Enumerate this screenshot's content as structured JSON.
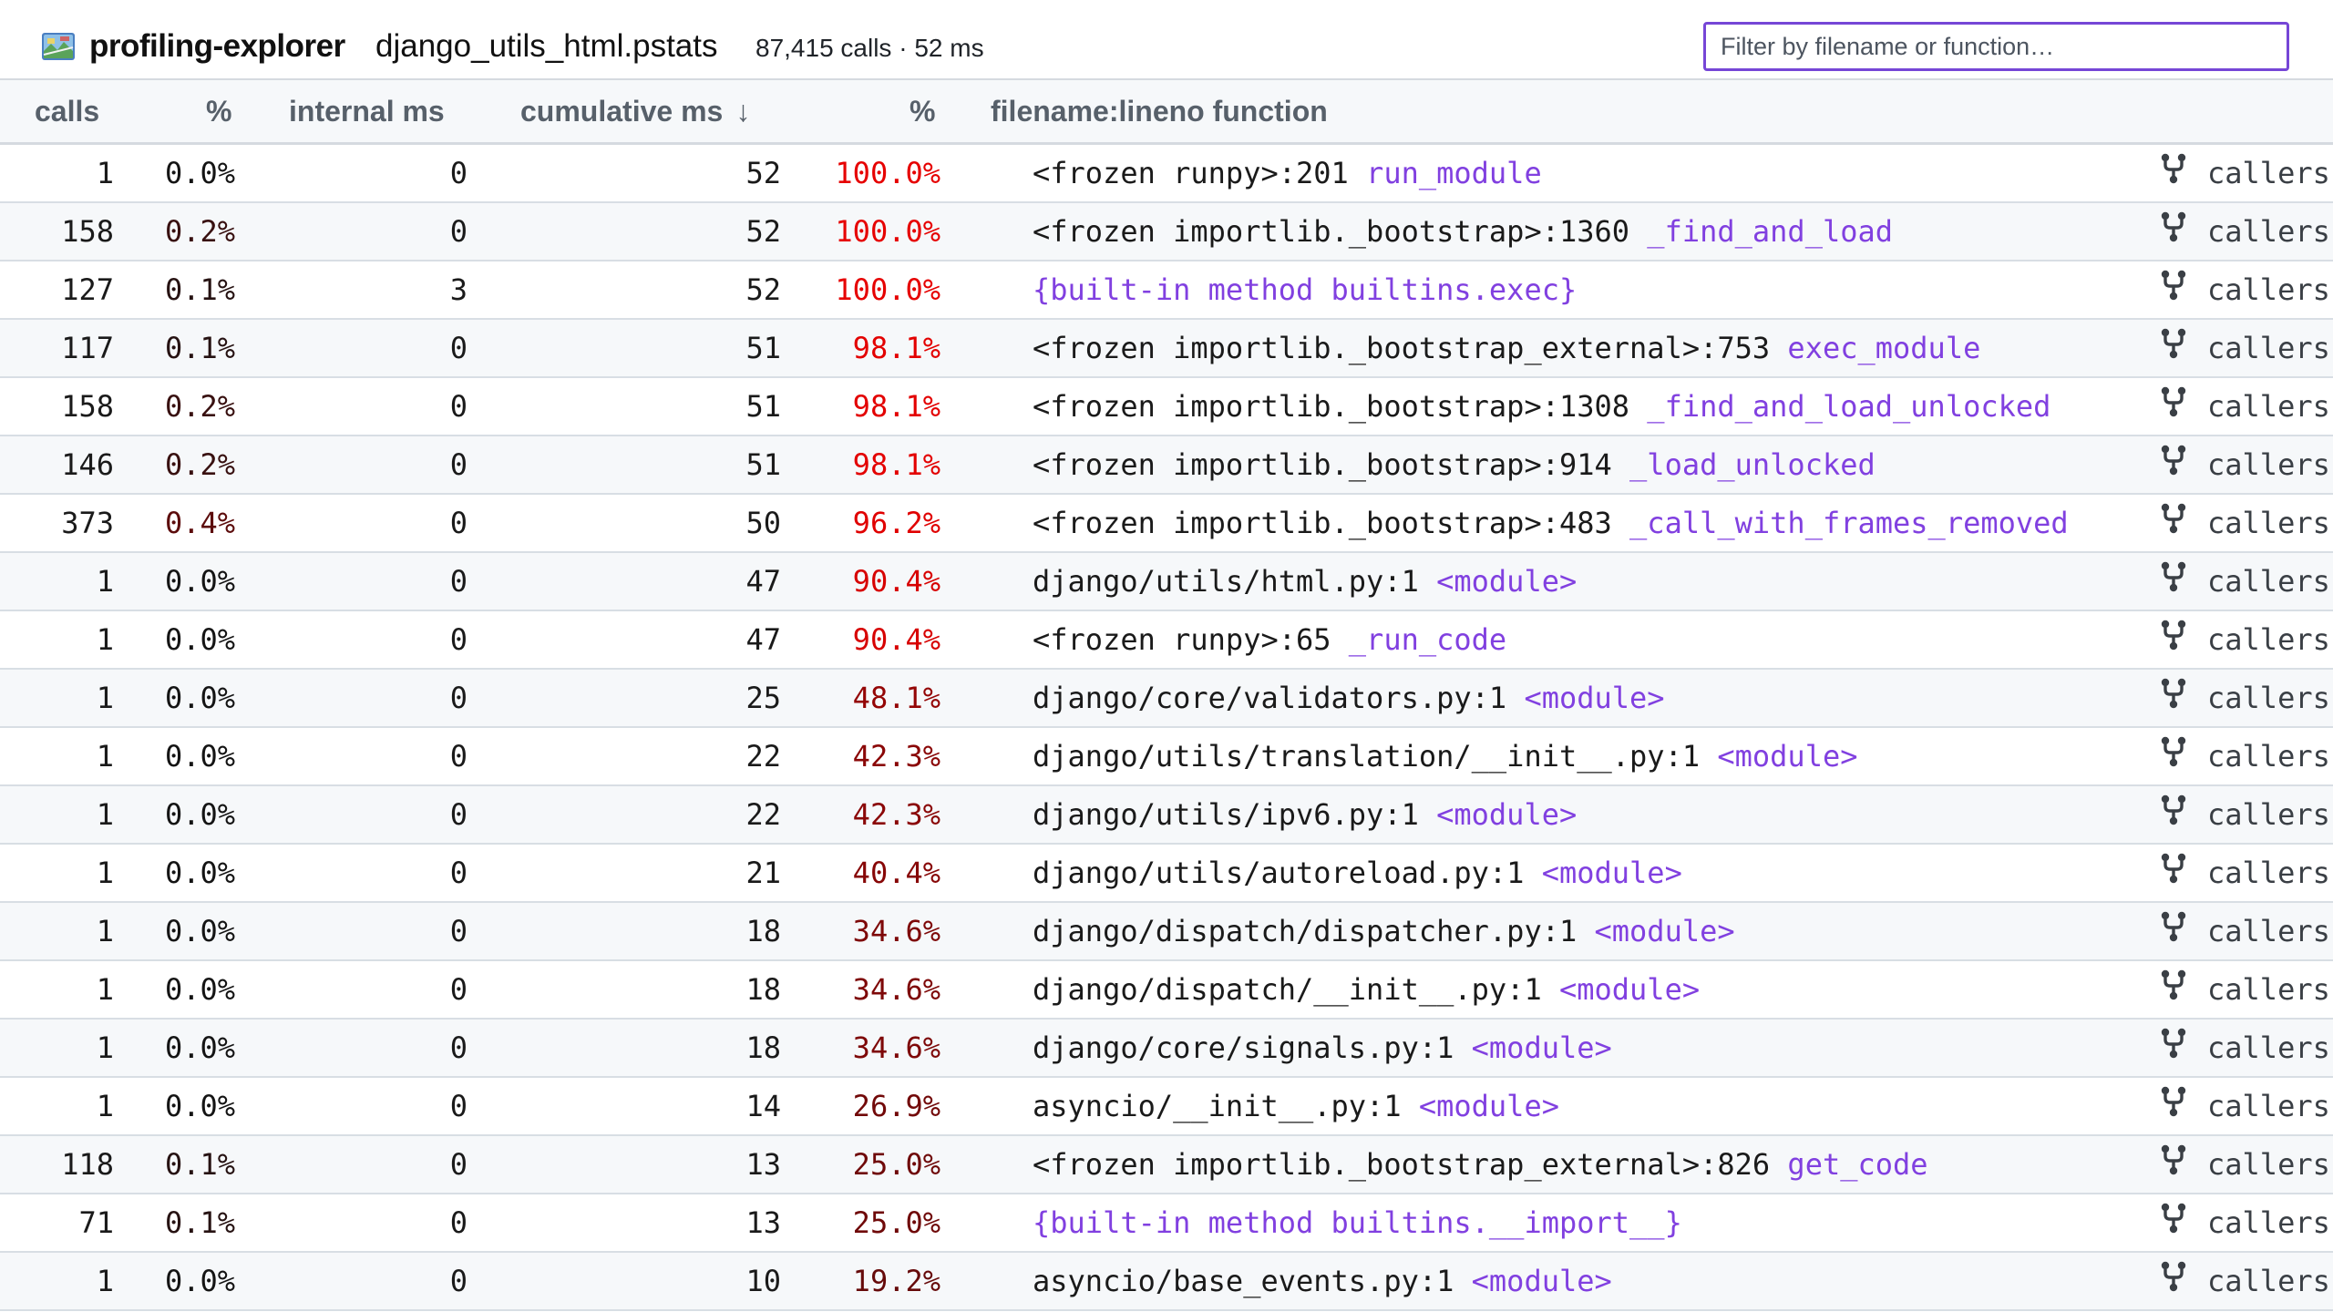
{
  "header": {
    "app_title": "profiling-explorer",
    "file_name": "django_utils_html.pstats",
    "stats": "87,415 calls · 52 ms",
    "filter_placeholder": "Filter by filename or function…"
  },
  "columns": {
    "calls": "calls",
    "pct1": "%",
    "internal": "internal ms",
    "cumulative": "cumulative ms",
    "sort_arrow": "↓",
    "pct2": "%",
    "function": "filename:lineno function"
  },
  "callers_label": "callers",
  "icons": {
    "logo": "map-icon",
    "callers": "fork-icon"
  },
  "colors": {
    "accent": "#7646d6",
    "function_name": "#8140e0"
  },
  "rows": [
    {
      "calls": "1",
      "pct1": "0.0%",
      "pct1_val": 0.0,
      "internal": "0",
      "cumulative": "52",
      "pct2": "100.0%",
      "pct2_val": 100.0,
      "file": "<frozen runpy>:201 ",
      "func": "run_module"
    },
    {
      "calls": "158",
      "pct1": "0.2%",
      "pct1_val": 0.2,
      "internal": "0",
      "cumulative": "52",
      "pct2": "100.0%",
      "pct2_val": 100.0,
      "file": "<frozen importlib._bootstrap>:1360 ",
      "func": "_find_and_load"
    },
    {
      "calls": "127",
      "pct1": "0.1%",
      "pct1_val": 0.1,
      "internal": "3",
      "cumulative": "52",
      "pct2": "100.0%",
      "pct2_val": 100.0,
      "file": "",
      "func": "{built-in method builtins.exec}"
    },
    {
      "calls": "117",
      "pct1": "0.1%",
      "pct1_val": 0.1,
      "internal": "0",
      "cumulative": "51",
      "pct2": "98.1%",
      "pct2_val": 98.1,
      "file": "<frozen importlib._bootstrap_external>:753 ",
      "func": "exec_module"
    },
    {
      "calls": "158",
      "pct1": "0.2%",
      "pct1_val": 0.2,
      "internal": "0",
      "cumulative": "51",
      "pct2": "98.1%",
      "pct2_val": 98.1,
      "file": "<frozen importlib._bootstrap>:1308 ",
      "func": "_find_and_load_unlocked"
    },
    {
      "calls": "146",
      "pct1": "0.2%",
      "pct1_val": 0.2,
      "internal": "0",
      "cumulative": "51",
      "pct2": "98.1%",
      "pct2_val": 98.1,
      "file": "<frozen importlib._bootstrap>:914 ",
      "func": "_load_unlocked"
    },
    {
      "calls": "373",
      "pct1": "0.4%",
      "pct1_val": 0.4,
      "internal": "0",
      "cumulative": "50",
      "pct2": "96.2%",
      "pct2_val": 96.2,
      "file": "<frozen importlib._bootstrap>:483 ",
      "func": "_call_with_frames_removed"
    },
    {
      "calls": "1",
      "pct1": "0.0%",
      "pct1_val": 0.0,
      "internal": "0",
      "cumulative": "47",
      "pct2": "90.4%",
      "pct2_val": 90.4,
      "file": "django/utils/html.py:1 ",
      "func": "<module>"
    },
    {
      "calls": "1",
      "pct1": "0.0%",
      "pct1_val": 0.0,
      "internal": "0",
      "cumulative": "47",
      "pct2": "90.4%",
      "pct2_val": 90.4,
      "file": "<frozen runpy>:65 ",
      "func": "_run_code"
    },
    {
      "calls": "1",
      "pct1": "0.0%",
      "pct1_val": 0.0,
      "internal": "0",
      "cumulative": "25",
      "pct2": "48.1%",
      "pct2_val": 48.1,
      "file": "django/core/validators.py:1 ",
      "func": "<module>"
    },
    {
      "calls": "1",
      "pct1": "0.0%",
      "pct1_val": 0.0,
      "internal": "0",
      "cumulative": "22",
      "pct2": "42.3%",
      "pct2_val": 42.3,
      "file": "django/utils/translation/__init__.py:1 ",
      "func": "<module>"
    },
    {
      "calls": "1",
      "pct1": "0.0%",
      "pct1_val": 0.0,
      "internal": "0",
      "cumulative": "22",
      "pct2": "42.3%",
      "pct2_val": 42.3,
      "file": "django/utils/ipv6.py:1 ",
      "func": "<module>"
    },
    {
      "calls": "1",
      "pct1": "0.0%",
      "pct1_val": 0.0,
      "internal": "0",
      "cumulative": "21",
      "pct2": "40.4%",
      "pct2_val": 40.4,
      "file": "django/utils/autoreload.py:1 ",
      "func": "<module>"
    },
    {
      "calls": "1",
      "pct1": "0.0%",
      "pct1_val": 0.0,
      "internal": "0",
      "cumulative": "18",
      "pct2": "34.6%",
      "pct2_val": 34.6,
      "file": "django/dispatch/dispatcher.py:1 ",
      "func": "<module>"
    },
    {
      "calls": "1",
      "pct1": "0.0%",
      "pct1_val": 0.0,
      "internal": "0",
      "cumulative": "18",
      "pct2": "34.6%",
      "pct2_val": 34.6,
      "file": "django/dispatch/__init__.py:1 ",
      "func": "<module>"
    },
    {
      "calls": "1",
      "pct1": "0.0%",
      "pct1_val": 0.0,
      "internal": "0",
      "cumulative": "18",
      "pct2": "34.6%",
      "pct2_val": 34.6,
      "file": "django/core/signals.py:1 ",
      "func": "<module>"
    },
    {
      "calls": "1",
      "pct1": "0.0%",
      "pct1_val": 0.0,
      "internal": "0",
      "cumulative": "14",
      "pct2": "26.9%",
      "pct2_val": 26.9,
      "file": "asyncio/__init__.py:1 ",
      "func": "<module>"
    },
    {
      "calls": "118",
      "pct1": "0.1%",
      "pct1_val": 0.1,
      "internal": "0",
      "cumulative": "13",
      "pct2": "25.0%",
      "pct2_val": 25.0,
      "file": "<frozen importlib._bootstrap_external>:826 ",
      "func": "get_code"
    },
    {
      "calls": "71",
      "pct1": "0.1%",
      "pct1_val": 0.1,
      "internal": "0",
      "cumulative": "13",
      "pct2": "25.0%",
      "pct2_val": 25.0,
      "file": "",
      "func": "{built-in method builtins.__import__}"
    },
    {
      "calls": "1",
      "pct1": "0.0%",
      "pct1_val": 0.0,
      "internal": "0",
      "cumulative": "10",
      "pct2": "19.2%",
      "pct2_val": 19.2,
      "file": "asyncio/base_events.py:1 ",
      "func": "<module>"
    }
  ]
}
